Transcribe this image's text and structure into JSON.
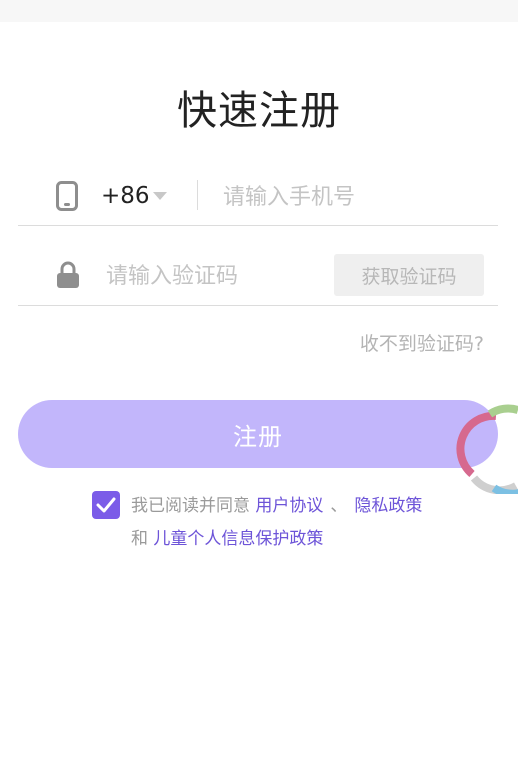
{
  "page": {
    "title": "快速注册"
  },
  "phone": {
    "country_code": "+86",
    "placeholder": "请输入手机号"
  },
  "code": {
    "placeholder": "请输入验证码",
    "get_code_label": "获取验证码"
  },
  "help": {
    "no_code_label": "收不到验证码?"
  },
  "register": {
    "label": "注册"
  },
  "agreement": {
    "checked": true,
    "prefix": "我已阅读并同意",
    "user_agreement": "用户协议",
    "separator": "、",
    "privacy_policy": "隐私政策",
    "and": "和",
    "child_policy": "儿童个人信息保护政策"
  },
  "colors": {
    "accent": "#7b5ce8",
    "button": "#c2b6fb",
    "link": "#6d54d8"
  },
  "icons": {
    "phone": "phone-icon",
    "lock": "lock-icon",
    "dropdown": "caret-down-icon",
    "check": "check-icon",
    "loading": "loading-spinner-icon"
  }
}
